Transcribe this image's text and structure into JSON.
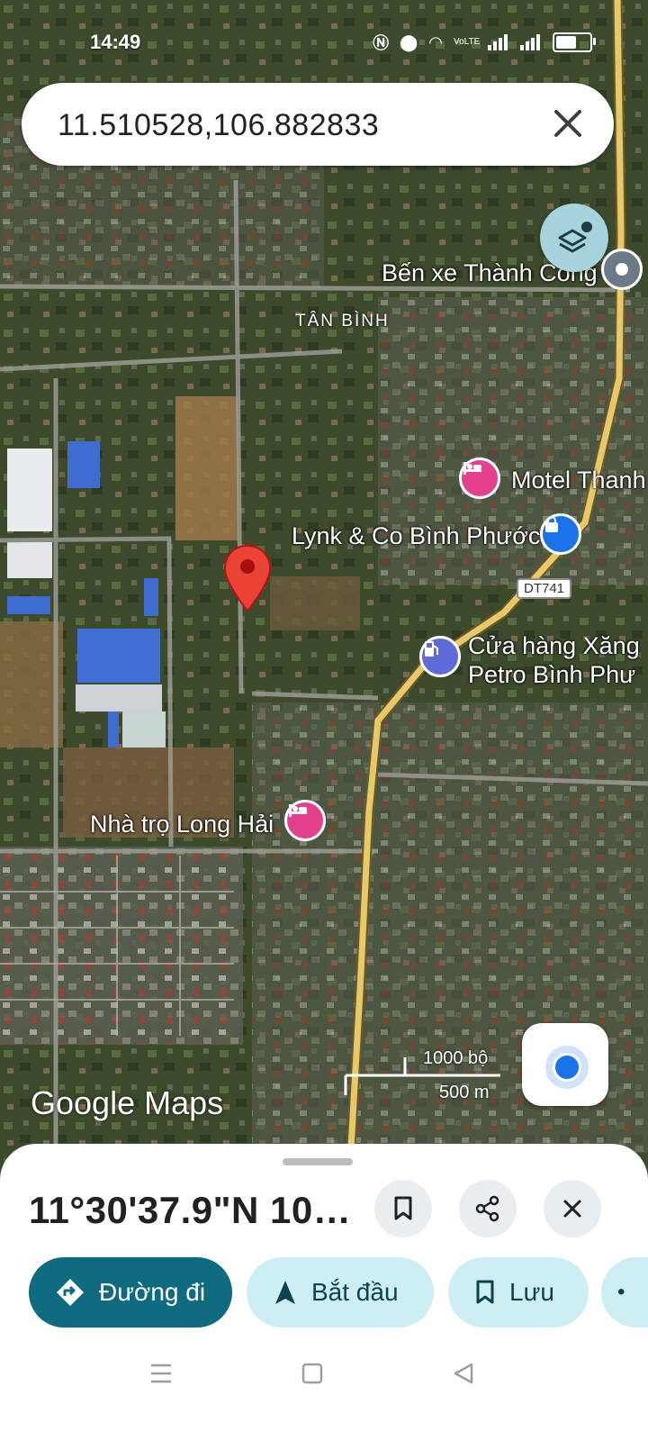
{
  "status_bar": {
    "time": "14:49",
    "network": "VoLTE"
  },
  "search": {
    "query": "11.510528,106.882833"
  },
  "map": {
    "area_label": "TÂN BÌNH",
    "places": [
      {
        "label": "Bến xe Thành Công",
        "icon": "bus-station-icon"
      },
      {
        "label": "Motel Thanh",
        "icon": "hotel-icon"
      },
      {
        "label": "Lynk & Co Bình Phước",
        "icon": "shopping-bag-icon"
      },
      {
        "label": "Cửa hàng Xăng",
        "label2": "Petro Bình Phư",
        "icon": "gas-station-icon"
      },
      {
        "label": "Nhà trọ Long Hải",
        "icon": "hotel-icon"
      }
    ],
    "route_shield": "DT741",
    "scale": {
      "imperial": "1000 bộ",
      "metric": "500 m"
    },
    "attribution": "Google Maps",
    "colors": {
      "road": "#e8c96a",
      "hotel_poi": "#e5408e",
      "shop_poi": "#1a73e8",
      "gas_poi": "#5e6bd8",
      "pin": "#ea4335"
    }
  },
  "sheet": {
    "coordinates": "11°30'37.9\"N 106...",
    "actions": {
      "directions": "Đường đi",
      "start": "Bắt đầu",
      "save": "Lưu"
    }
  }
}
